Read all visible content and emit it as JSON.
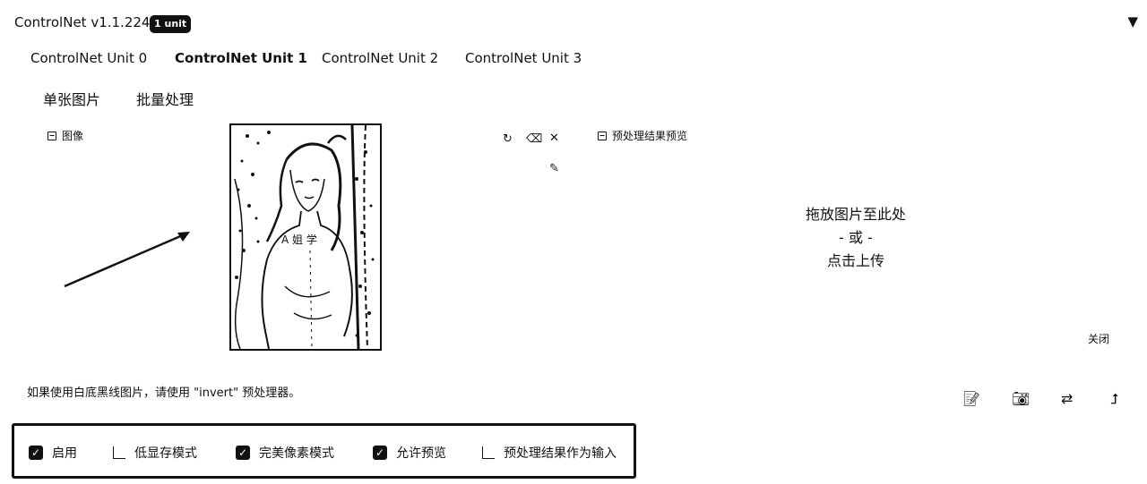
{
  "header": {
    "title": "ControlNet v1.1.224",
    "badge": "1 unit",
    "collapse_icon": "triangle-down-icon"
  },
  "tabs": [
    {
      "label": "ControlNet Unit 0",
      "active": false
    },
    {
      "label": "ControlNet Unit 1",
      "active": true
    },
    {
      "label": "ControlNet Unit 2",
      "active": false
    },
    {
      "label": "ControlNet Unit 3",
      "active": false
    }
  ],
  "subtabs": [
    {
      "label": "单张图片",
      "active": true
    },
    {
      "label": "批量处理",
      "active": false
    }
  ],
  "input_panel": {
    "label": "图像",
    "tools": [
      "undo-icon",
      "eraser-icon",
      "close-icon",
      "brush-icon"
    ]
  },
  "preview_panel": {
    "label": "预处理结果预览",
    "drop_line1": "拖放图片至此处",
    "drop_line2": "- 或 -",
    "drop_line3": "点击上传",
    "close_label": "关闭"
  },
  "hint": "如果使用白底黑线图片，请使用 \"invert\" 预处理器。",
  "bottom_icons": [
    "pencil-doc-icon",
    "camera-icon",
    "swap-icon",
    "send-arrow-icon"
  ],
  "options": [
    {
      "label": "启用",
      "checked": true
    },
    {
      "label": "低显存模式",
      "checked": false
    },
    {
      "label": "完美像素模式",
      "checked": true
    },
    {
      "label": "允许预览",
      "checked": true
    },
    {
      "label": "预处理结果作为输入",
      "checked": false
    }
  ],
  "colors": {
    "text": "#111111",
    "background": "#ffffff",
    "badge_bg": "#111111"
  }
}
